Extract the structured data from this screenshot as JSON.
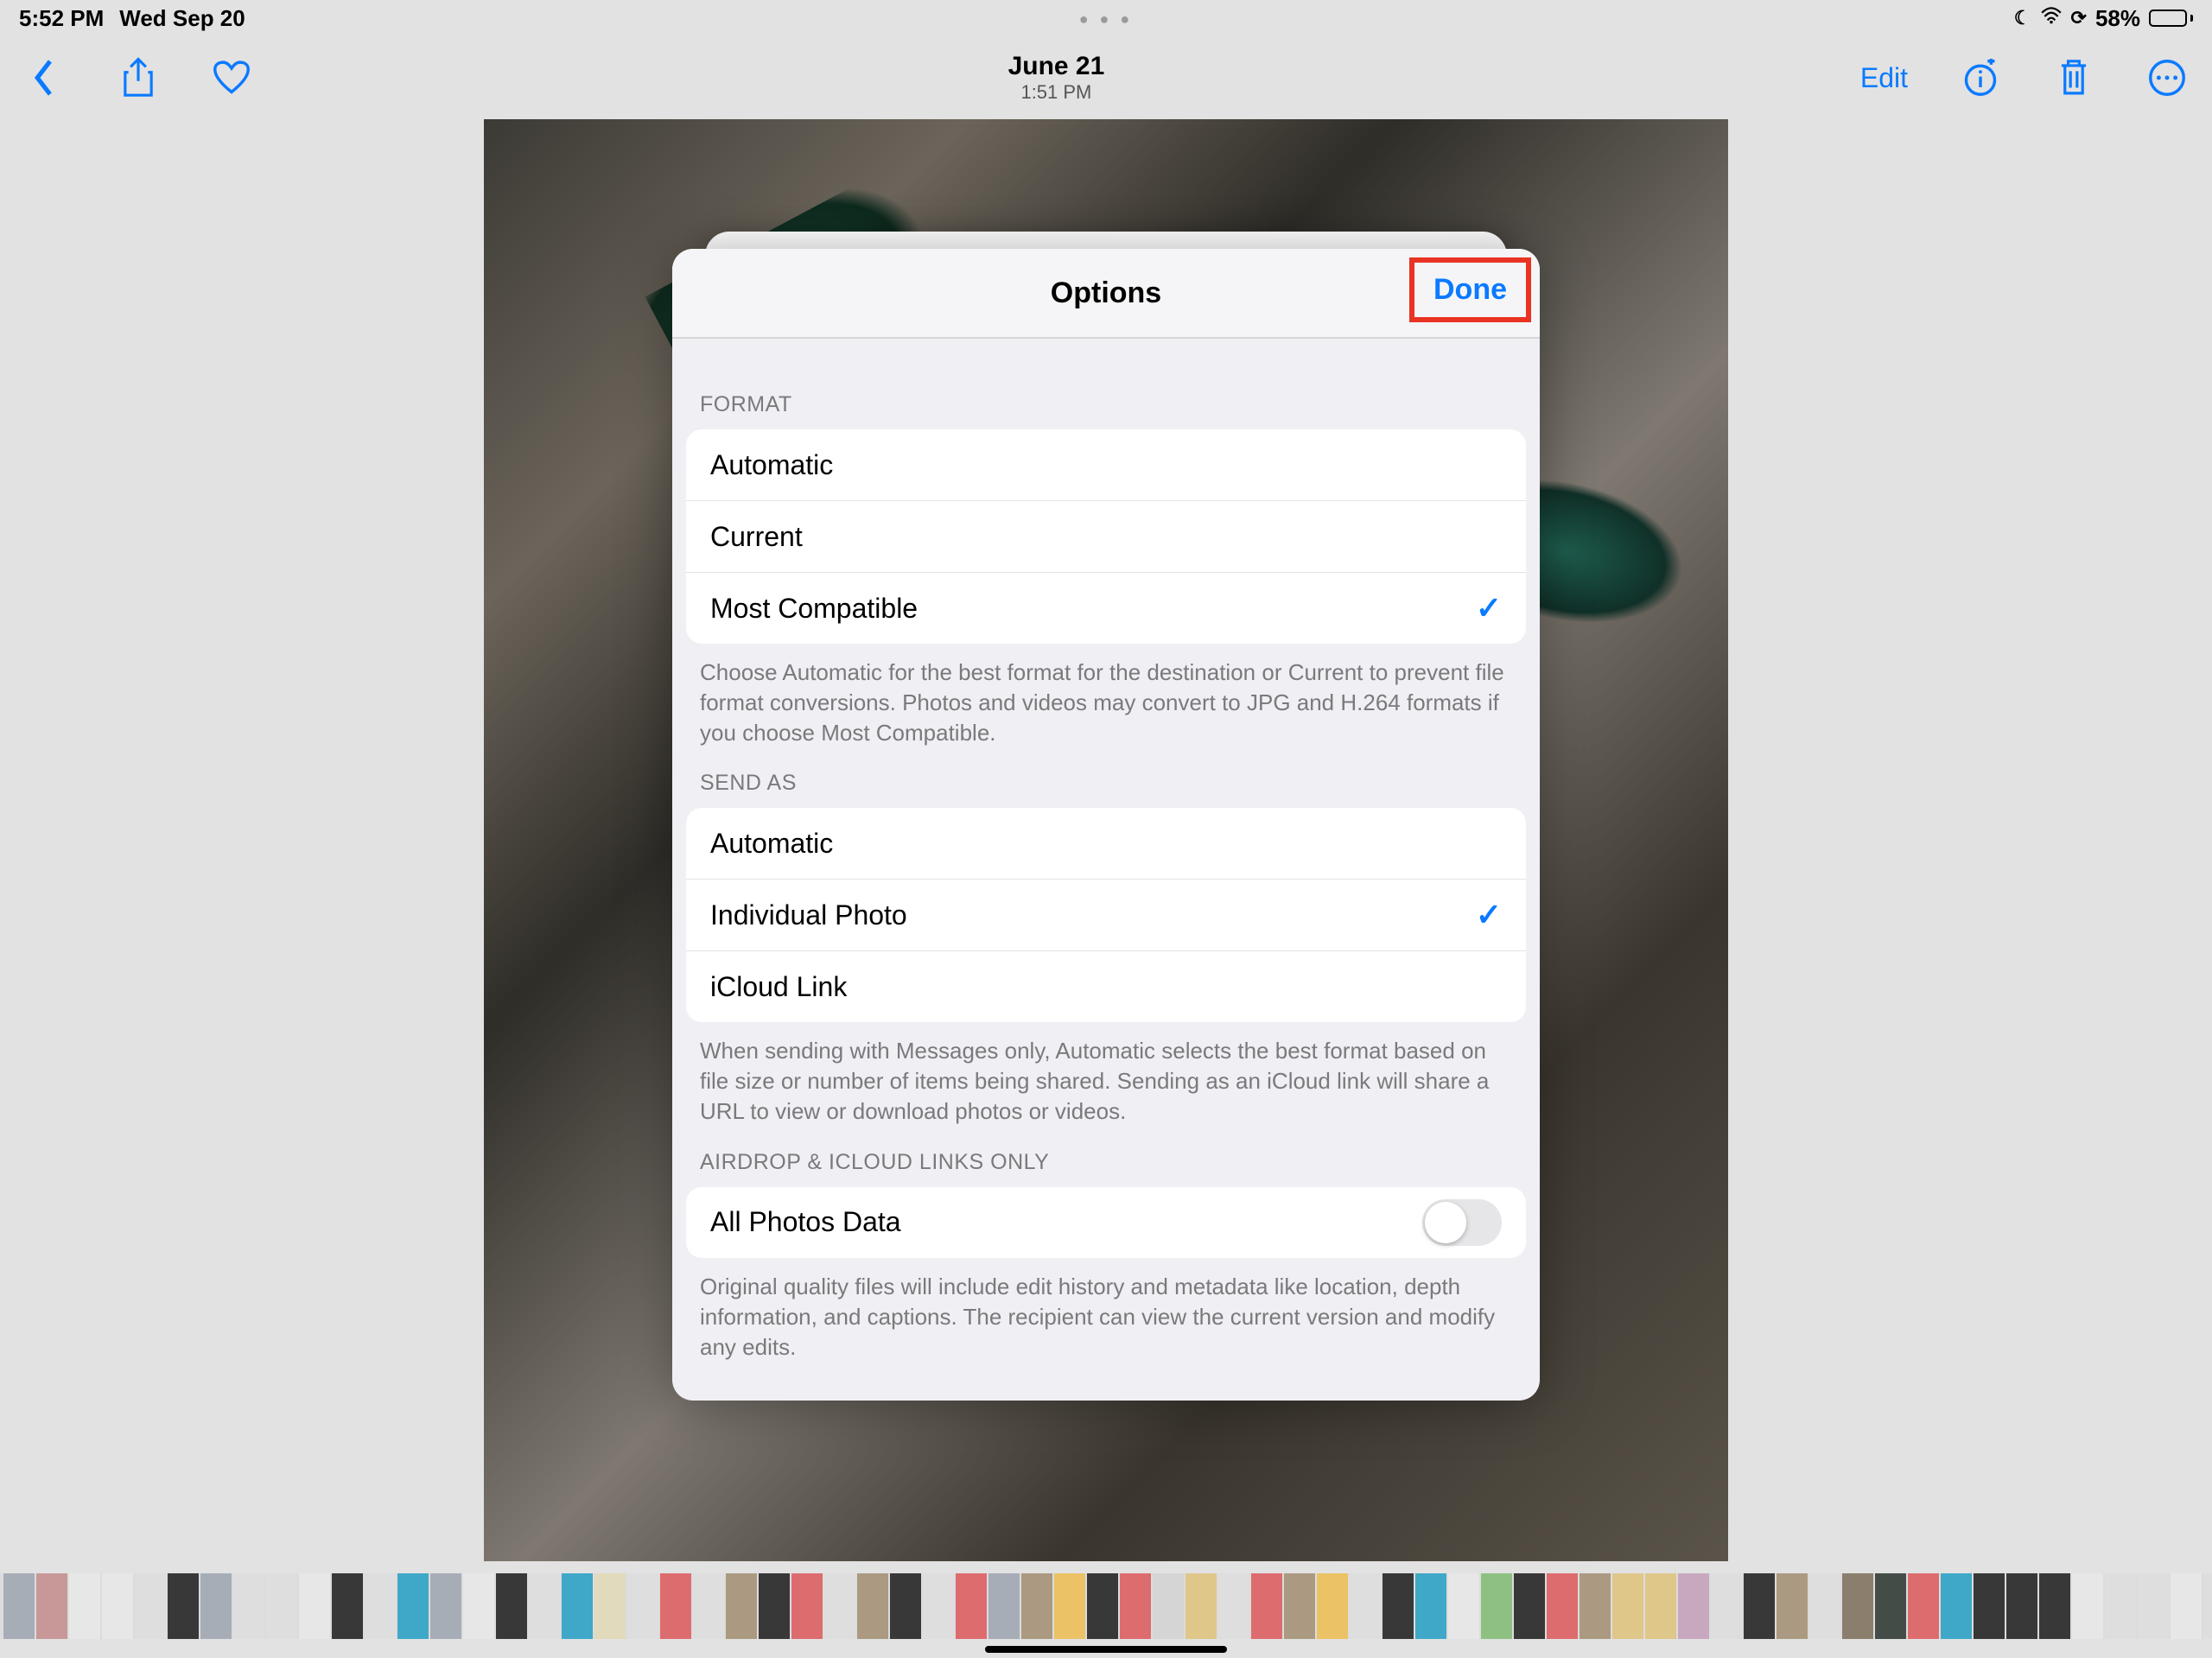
{
  "status": {
    "time": "5:52 PM",
    "date": "Wed Sep 20",
    "battery": "58%"
  },
  "nav": {
    "photo_date": "June 21",
    "photo_time": "1:51 PM",
    "edit": "Edit"
  },
  "sheet": {
    "title": "Options",
    "done": "Done",
    "sections": [
      {
        "header": "FORMAT",
        "rows": [
          {
            "label": "Automatic",
            "checked": false
          },
          {
            "label": "Current",
            "checked": false
          },
          {
            "label": "Most Compatible",
            "checked": true
          }
        ],
        "footnote": "Choose Automatic for the best format for the destination or Current to prevent file format conversions. Photos and videos may convert to JPG and H.264 formats if you choose Most Compatible."
      },
      {
        "header": "SEND AS",
        "rows": [
          {
            "label": "Automatic",
            "checked": false
          },
          {
            "label": "Individual Photo",
            "checked": true
          },
          {
            "label": "iCloud Link",
            "checked": false
          }
        ],
        "footnote": "When sending with Messages only, Automatic selects the best format based on file size or number of items being shared. Sending as an iCloud link will share a URL to view or download photos or videos."
      },
      {
        "header": "AIRDROP & ICLOUD LINKS ONLY",
        "toggle": {
          "label": "All Photos Data",
          "on": false
        },
        "footnote": "Original quality files will include edit history and metadata like location, depth information, and captions. The recipient can view the current version and modify any edits."
      }
    ]
  },
  "thumb_colors": [
    "#9ea6b3",
    "#c98b8b",
    "#f0f0f0",
    "#f0f0f0",
    "#e4e4e4",
    "#111",
    "#9ea6b3",
    "#e4e4e4",
    "#e4e4e4",
    "#f0f0f0",
    "#111",
    "#e4e4e4",
    "#1aa0c9",
    "#9ea6b3",
    "#f0f0f0",
    "#111",
    "#e4e4e4",
    "#1aa0c9",
    "#e8dfb8",
    "#e4e4e4",
    "#e35457",
    "#e4e4e4",
    "#a48e6e",
    "#111",
    "#e35457",
    "#e4e4e4",
    "#a48e6e",
    "#111",
    "#e4e4e4",
    "#e35457",
    "#9ea6b3",
    "#a48e6e",
    "#f5c04a",
    "#111",
    "#e35457",
    "#d9d9d9",
    "#e6c77a",
    "#e4e4e4",
    "#e35457",
    "#a48e6e",
    "#f5c04a",
    "#e4e4e4",
    "#111",
    "#1aa0c9",
    "#f0f0f0",
    "#7fbf6e",
    "#111",
    "#e35457",
    "#a48e6e",
    "#e6c77a",
    "#e6c77a",
    "#c89fbd",
    "#e4e4e4",
    "#111",
    "#a48e6e",
    "#e4e4e4",
    "#7b6a52",
    "#1f2a24",
    "#e35457",
    "#1aa0c9",
    "#111",
    "#111",
    "#111",
    "#f0f0f0",
    "#e4e4e4",
    "#e4e4e4",
    "#f0f0f0",
    "#e4e4e4",
    "#e35457",
    "#e4e4e4",
    "#e4e4e4",
    "#f0f0f0",
    "#e4e4e4",
    "#f0f0f0",
    "#e4e4e4",
    "#e4e4e4",
    "#f0f0f0",
    "#e4e4e4",
    "#f0f0f0",
    "#e4e4e4",
    "#e4e4e4",
    "#dcdcdc"
  ]
}
